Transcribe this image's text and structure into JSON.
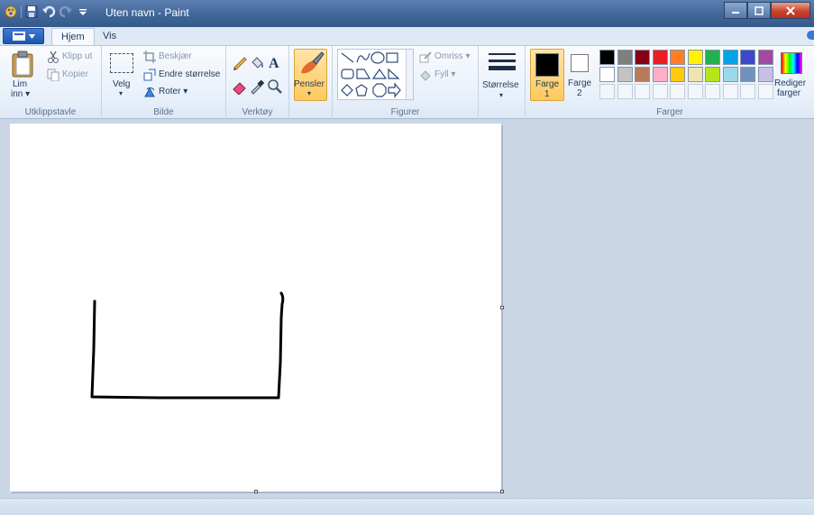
{
  "window": {
    "title": "Uten navn - Paint"
  },
  "tabs": [
    {
      "label": "Hjem",
      "active": true
    },
    {
      "label": "Vis",
      "active": false
    }
  ],
  "clipboard": {
    "group_label": "Utklippstavle",
    "paste_label_1": "Lim",
    "paste_label_2": "inn ▾",
    "cut_label": "Klipp ut",
    "copy_label": "Kopier"
  },
  "image": {
    "group_label": "Bilde",
    "select_label": "Velg",
    "select_arrow": "▾",
    "crop_label": "Beskjær",
    "resize_label": "Endre størrelse",
    "rotate_label": "Roter ▾"
  },
  "tools": {
    "group_label": "Verktøy"
  },
  "brushes": {
    "label": "Pensler",
    "arrow": "▾"
  },
  "shapes": {
    "group_label": "Figurer",
    "outline_label": "Omriss ▾",
    "fill_label": "Fyll ▾"
  },
  "size": {
    "label": "Størrelse",
    "arrow": "▾"
  },
  "colors": {
    "group_label": "Farger",
    "color1_label_1": "Farge",
    "color1_label_2": "1",
    "color2_label_1": "Farge",
    "color2_label_2": "2",
    "edit_label_1": "Rediger",
    "edit_label_2": "farger",
    "color1_value": "#000000",
    "color2_value": "#ffffff",
    "palette_row1": [
      "#000000",
      "#7f7f7f",
      "#880015",
      "#ed1c24",
      "#ff7f27",
      "#fff200",
      "#22b14c",
      "#00a2e8",
      "#3f48cc",
      "#a349a4"
    ],
    "palette_row2": [
      "#ffffff",
      "#c3c3c3",
      "#b97a57",
      "#ffaec9",
      "#ffc90e",
      "#efe4b0",
      "#b5e61d",
      "#99d9ea",
      "#7092be",
      "#c8bfe7"
    ]
  }
}
